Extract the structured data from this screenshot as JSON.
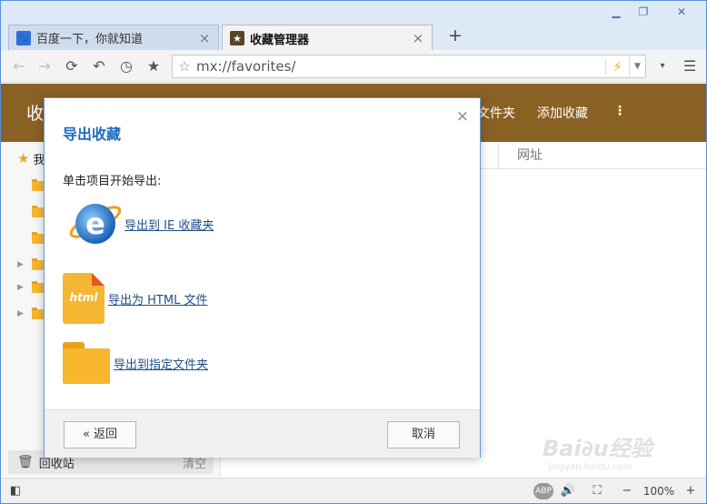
{
  "window": {
    "controls": {
      "minimize": "▁",
      "restore": "❐",
      "close": "✕"
    },
    "new_tab": "+"
  },
  "tabs": [
    {
      "title": "百度一下，你就知道",
      "favicon": "baidu-paw-icon",
      "favicon_color": "#2f6fd8",
      "active": false,
      "close": "×"
    },
    {
      "title": "收藏管理器",
      "favicon": "star-icon",
      "favicon_color": "#5a4522",
      "active": true,
      "close": "×"
    }
  ],
  "toolbar": {
    "address": "mx://favorites/",
    "icons": [
      "back-icon",
      "forward-icon",
      "refresh-icon",
      "undo-icon",
      "history-icon",
      "favorites-star-icon",
      "menu-icon"
    ]
  },
  "favorites_page": {
    "title": "收",
    "actions": [
      "文件夹",
      "添加收藏",
      "⋮"
    ],
    "column_url": "网址",
    "sidebar_root": "我",
    "recycle_bin": "回收站",
    "clear": "清空"
  },
  "dialog": {
    "title": "导出收藏",
    "prompt": "单击项目开始导出:",
    "options": [
      {
        "label": "导出到 IE 收藏夹",
        "icon": "internet-explorer-icon"
      },
      {
        "label": "导出为 HTML 文件",
        "icon": "html-file-icon",
        "icon_text": "html"
      },
      {
        "label": "导出到指定文件夹",
        "icon": "folder-icon"
      }
    ],
    "back_button": "« 返回",
    "cancel_button": "取消",
    "close": "×"
  },
  "statusbar": {
    "zoom": "100%",
    "zoom_out": "−",
    "zoom_in": "+"
  },
  "watermark": {
    "line1": "Bai∂u经验",
    "line2": "jingyan.baidu.com"
  },
  "colors": {
    "accent_brown": "#8a6125",
    "dialog_title": "#1e6bc2",
    "link": "#1f4f86",
    "folder": "#f5b731"
  }
}
